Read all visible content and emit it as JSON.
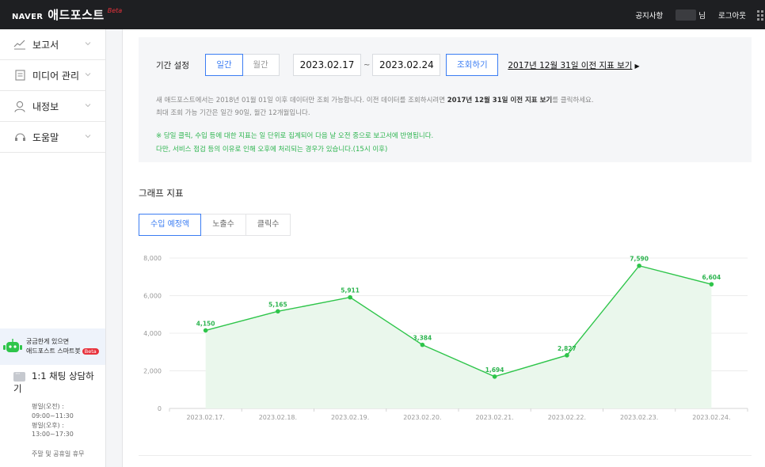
{
  "header": {
    "naver": "NAVER",
    "brand": "애드포스트",
    "beta": "Beta",
    "notice": "공지사항",
    "nim": "님",
    "logout": "로그아웃"
  },
  "sidebar": {
    "items": [
      {
        "label": "보고서",
        "icon": "chart-line-icon"
      },
      {
        "label": "미디어 관리",
        "icon": "document-icon"
      },
      {
        "label": "내정보",
        "icon": "person-icon"
      },
      {
        "label": "도움말",
        "icon": "headset-icon"
      }
    ],
    "chatbot": {
      "line1": "궁금한게 있으면",
      "line2": "애드포스트 스마트봇",
      "badge": "Beta"
    },
    "chat": {
      "title1": "1:1 채팅 상담하",
      "title2": "기",
      "hours": [
        "평일(오전) :",
        "09:00~11:30",
        "평일(오후) :",
        "13:00~17:30"
      ],
      "holiday": "주말 및 공휴일 휴무"
    }
  },
  "filter": {
    "period_label": "기간 설정",
    "options": [
      "일간",
      "월간"
    ],
    "selected": "일간",
    "start_date": "2023.02.17",
    "tilde": "~",
    "end_date": "2023.02.24",
    "search_button": "조회하기",
    "old_link": "2017년 12월 31일 이전 지표 보기",
    "info1_a": "새 애드포스트에서는 2018년 01월 01일 이후 데이터만 조회 가능합니다. 이전 데이터를 조회하시려면 ",
    "info1_b": "2017년 12월 31일 이전 지표 보기",
    "info1_c": "를 클릭하세요.",
    "info1_line2": "최대 조회 가능 기간은 일간 90일, 월간 12개월입니다.",
    "info2_line1": "※ 당일 클릭, 수입 등에 대한 지표는 일 단위로 집계되어 다음 날 오전 중으로 보고서에 반영됩니다.",
    "info2_line2": "다만, 서비스 점검 등의 이유로 인해 오후에 처리되는 경우가 있습니다.(15시 이후)"
  },
  "graph": {
    "title": "그래프 지표",
    "tabs": [
      "수입 예정액",
      "노출수",
      "클릭수"
    ],
    "active_tab": "수입 예정액"
  },
  "chart_data": {
    "type": "line",
    "categories": [
      "2023.02.17.",
      "2023.02.18.",
      "2023.02.19.",
      "2023.02.20.",
      "2023.02.21.",
      "2023.02.22.",
      "2023.02.23.",
      "2023.02.24."
    ],
    "values": [
      4150,
      5165,
      5911,
      3384,
      1694,
      2827,
      7590,
      6604
    ],
    "value_labels": [
      "4,150",
      "5,165",
      "5,911",
      "3,384",
      "1,694",
      "2,827",
      "7,590",
      "6,604"
    ],
    "yticks": [
      0,
      2000,
      4000,
      6000,
      8000
    ],
    "ytick_labels": [
      "0",
      "2,000",
      "4,000",
      "6,000",
      "8,000"
    ],
    "ylim": [
      0,
      8000
    ],
    "line_color": "#2ec54a",
    "fill_color": "#eaf7ec",
    "grid": true
  },
  "colors": {
    "accent": "#3b7df3",
    "green": "#2eb550",
    "header": "#1e1f22"
  }
}
